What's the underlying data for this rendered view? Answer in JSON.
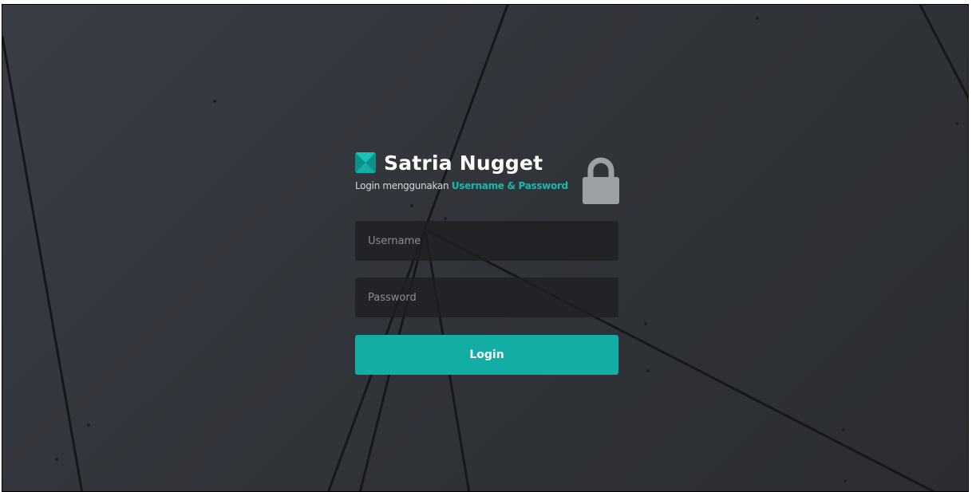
{
  "brand": {
    "title": "Satria Nugget",
    "logo_icon": "app-logo-icon"
  },
  "subtitle": {
    "prefix": "Login menggunakan ",
    "highlight": "Username & Password"
  },
  "lock_icon": "lock-icon",
  "form": {
    "username_placeholder": "Username",
    "username_value": "",
    "password_placeholder": "Password",
    "password_value": "",
    "login_label": "Login"
  },
  "colors": {
    "accent": "#12aea5",
    "background": "#33363c",
    "field_bg": "#1e1f22"
  }
}
